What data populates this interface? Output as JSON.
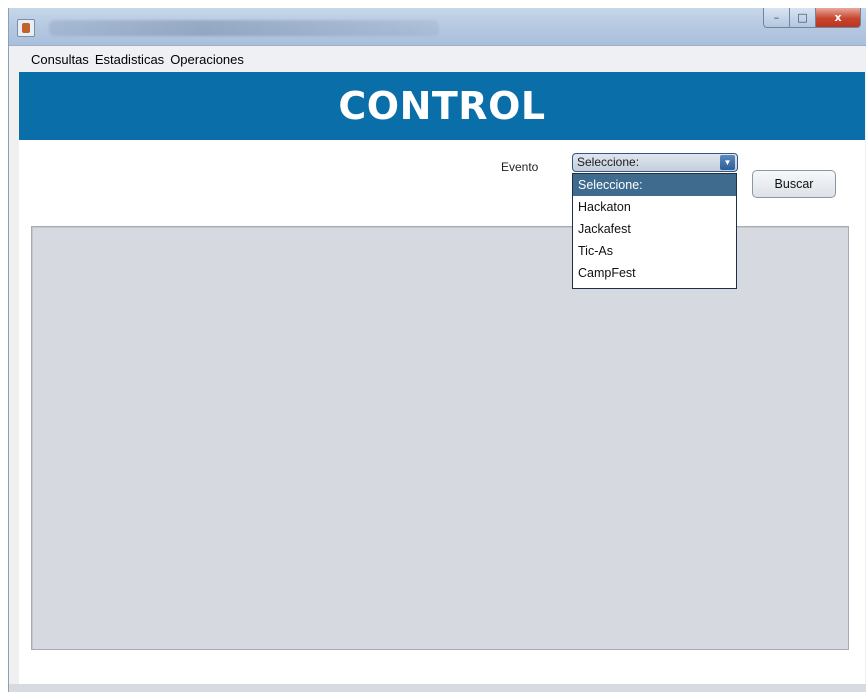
{
  "window": {
    "title": "",
    "controls": {
      "minimize": "–",
      "maximize": "□",
      "close": "x"
    }
  },
  "menu": {
    "items": [
      "Consultas",
      "Estadisticas",
      "Operaciones"
    ]
  },
  "header": {
    "title": "CONTROL",
    "background": "#0a6ea8"
  },
  "form": {
    "evento_label": "Evento",
    "combo_selected": "Seleccione:",
    "options": [
      "Seleccione:",
      "Hackaton",
      "Jackafest",
      "Tic-As",
      "CampFest"
    ],
    "selected_index": 0,
    "buscar_label": "Buscar"
  },
  "colors": {
    "accent": "#0a6ea8",
    "selection": "#3f6b8e",
    "panel": "#d6dae0"
  }
}
